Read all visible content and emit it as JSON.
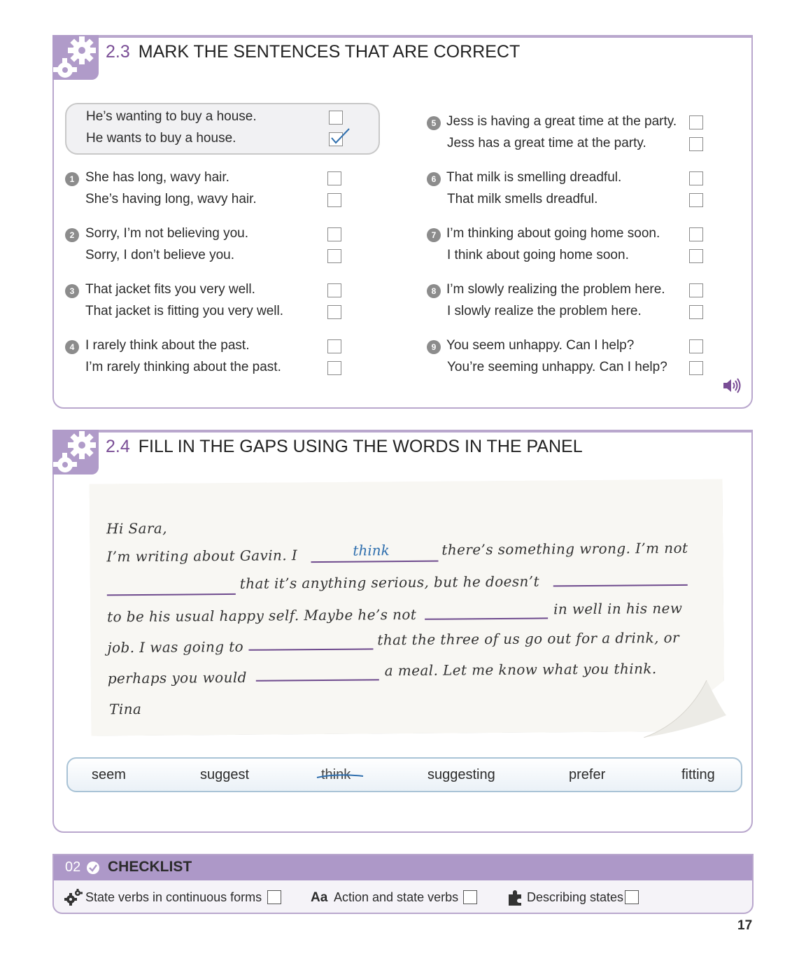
{
  "section_23": {
    "number": "2.3",
    "title": "MARK THE SENTENCES THAT ARE CORRECT",
    "example": [
      {
        "text": "He’s wanting to buy a house.",
        "checked": false
      },
      {
        "text": "He wants to buy a house.",
        "checked": true
      }
    ],
    "items": [
      {
        "n": "1",
        "a": "She has long, wavy hair.",
        "b": "She’s having long, wavy hair."
      },
      {
        "n": "2",
        "a": "Sorry, I’m not believing you.",
        "b": "Sorry, I don’t believe you."
      },
      {
        "n": "3",
        "a": "That jacket fits you very well.",
        "b": "That jacket is fitting you very well."
      },
      {
        "n": "4",
        "a": "I rarely think about the past.",
        "b": "I’m rarely thinking about the past."
      },
      {
        "n": "5",
        "a": "Jess is having a great time at the party.",
        "b": "Jess has a great time at the party."
      },
      {
        "n": "6",
        "a": "That milk is smelling dreadful.",
        "b": "That milk smells dreadful."
      },
      {
        "n": "7",
        "a": "I’m thinking about going home soon.",
        "b": "I think about going home soon."
      },
      {
        "n": "8",
        "a": "I’m slowly realizing the problem here.",
        "b": "I slowly realize the problem here."
      },
      {
        "n": "9",
        "a": "You seem unhappy. Can I help?",
        "b": "You’re seeming unhappy. Can I help?"
      }
    ]
  },
  "section_24": {
    "number": "2.4",
    "title": "FILL IN THE GAPS USING THE WORDS IN THE PANEL",
    "note": {
      "greeting": "Hi Sara,",
      "l1a": "I’m writing about Gavin. I",
      "l1_answer": "think",
      "l1b": "there’s something wrong. I’m not",
      "l2a": "that it’s anything serious, but he doesn’t",
      "l3a": "to be his usual happy self. Maybe he’s not",
      "l3b": "in well in his new",
      "l4a": "job. I was going to",
      "l4b": "that the three of us go out for a drink, or",
      "l5a": "perhaps you would",
      "l5b": "a meal. Let me know what you think.",
      "signoff": "Tina"
    },
    "words": [
      "seem",
      "suggest",
      "think",
      "suggesting",
      "prefer",
      "fitting"
    ],
    "crossed_word_index": 2
  },
  "checklist": {
    "number": "02",
    "title": "CHECKLIST",
    "items": [
      {
        "icon": "gears-icon",
        "label": "State verbs in continuous forms"
      },
      {
        "icon": "aa-icon",
        "icon_text": "Aa",
        "label": "Action and state verbs"
      },
      {
        "icon": "puzzle-icon",
        "label": "Describing states"
      }
    ]
  },
  "page_number": "17",
  "colors": {
    "accent": "#7a4e96",
    "panel_border": "#b9a7cd",
    "tab": "#b09bc9",
    "handwriting_answer": "#2f6fae"
  }
}
